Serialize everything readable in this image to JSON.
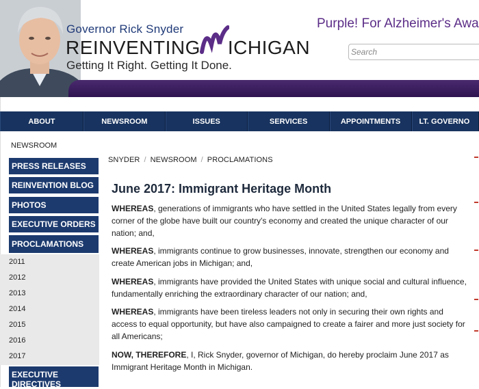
{
  "header": {
    "gov_name": "Governor Rick Snyder",
    "brand_left": "REINVENTING",
    "brand_right": "ICHIGAN",
    "tagline": "Getting It Right. Getting It Done.",
    "promo": "Purple! For Alzheimer's Awa",
    "search_placeholder": "Search",
    "colors": {
      "navy": "#18335f",
      "purple": "#5b2d87"
    }
  },
  "nav": {
    "items": [
      "ABOUT",
      "NEWSROOM",
      "ISSUES",
      "SERVICES",
      "APPOINTMENTS",
      "LT. GOVERNO"
    ]
  },
  "sidebar": {
    "heading": "NEWSROOM",
    "buttons": [
      "PRESS RELEASES",
      "REINVENTION BLOG",
      "PHOTOS",
      "EXECUTIVE ORDERS",
      "PROCLAMATIONS"
    ],
    "years": [
      "2011",
      "2012",
      "2013",
      "2014",
      "2015",
      "2016",
      "2017"
    ],
    "bottom_button": [
      "EXECUTIVE",
      "DIRECTIVES"
    ]
  },
  "breadcrumb": [
    "SNYDER",
    "NEWSROOM",
    "PROCLAMATIONS"
  ],
  "article": {
    "title": "June 2017: Immigrant Heritage Month",
    "paragraphs": [
      {
        "lead": "WHEREAS",
        "text": ", generations of immigrants who have settled in the United States legally from every corner of the globe have built our country's economy and created the unique character of our nation; and,"
      },
      {
        "lead": "WHEREAS",
        "text": ", immigrants continue to grow businesses, innovate, strengthen our economy and create American jobs in Michigan; and,"
      },
      {
        "lead": "WHEREAS",
        "text": ", immigrants have provided the United States with unique social and cultural influence, fundamentally enriching the extraordinary character of our nation; and,"
      },
      {
        "lead": "WHEREAS",
        "text": ", immigrants have been tireless leaders not only in securing their own rights and access to equal opportunity, but have also campaigned to create a fairer and more just society for all Americans;"
      },
      {
        "lead": "NOW, THEREFORE",
        "text": ", I, Rick Snyder, governor of Michigan, do hereby proclaim June 2017 as Immigrant Heritage Month in Michigan."
      }
    ]
  }
}
